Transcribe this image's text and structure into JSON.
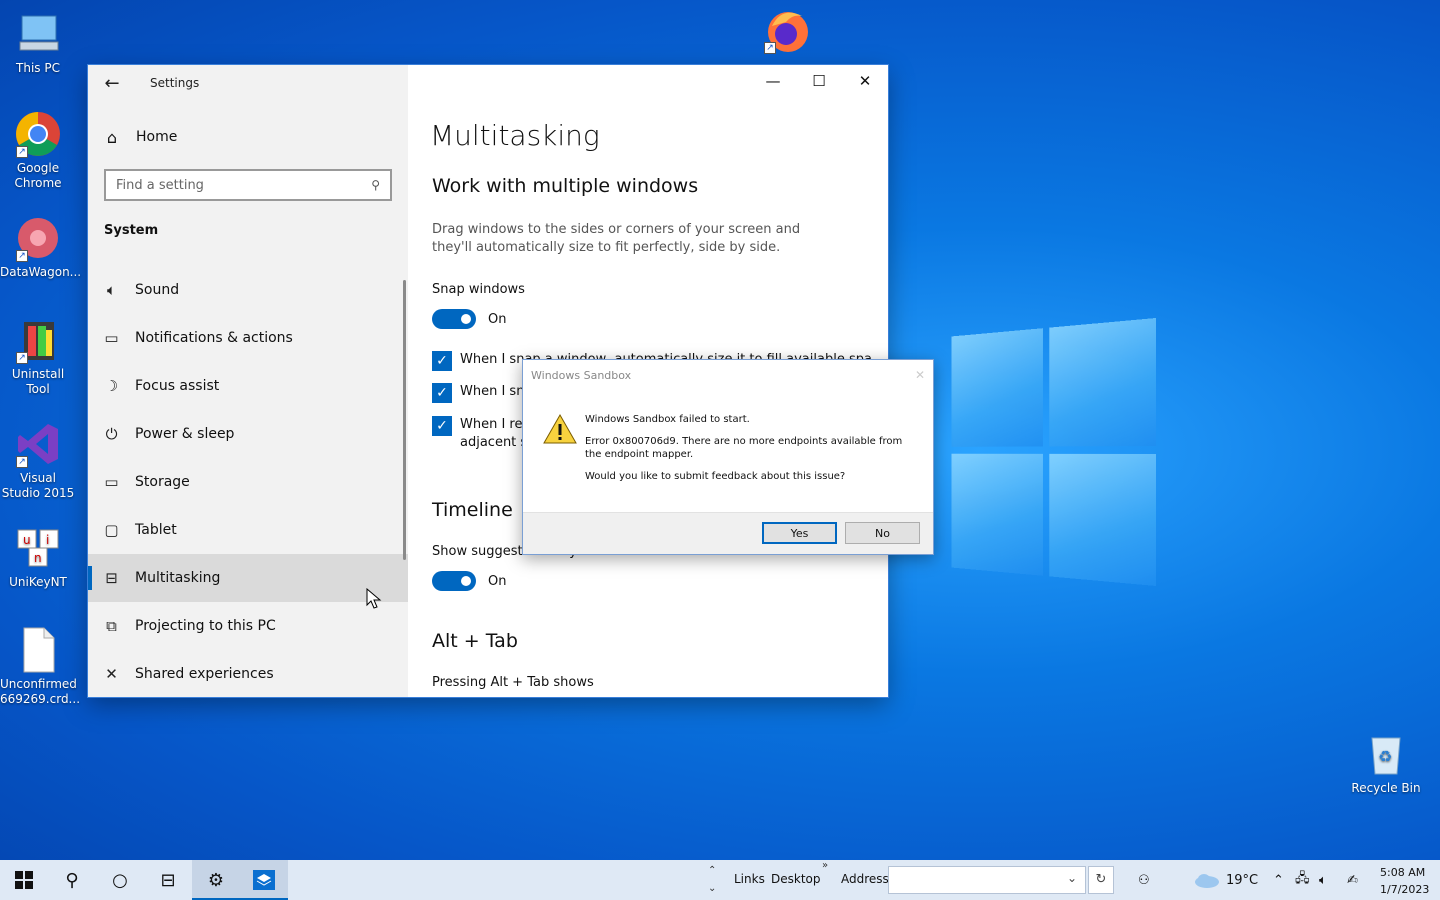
{
  "desktop": {
    "icons": [
      {
        "label": "This PC"
      },
      {
        "label": "Google Chrome"
      },
      {
        "label": "DataWagon..."
      },
      {
        "label": "Uninstall Tool"
      },
      {
        "label": "Visual Studio 2015"
      },
      {
        "label": "UniKeyNT"
      },
      {
        "label": "Unconfirmed 669269.crd..."
      },
      {
        "label": "Recycle Bin"
      }
    ]
  },
  "settings": {
    "title": "Settings",
    "home": "Home",
    "search_placeholder": "Find a setting",
    "section": "System",
    "nav": [
      {
        "label": "Sound",
        "icon": "speaker-icon"
      },
      {
        "label": "Notifications & actions",
        "icon": "notification-icon"
      },
      {
        "label": "Focus assist",
        "icon": "moon-icon"
      },
      {
        "label": "Power & sleep",
        "icon": "power-icon"
      },
      {
        "label": "Storage",
        "icon": "storage-icon"
      },
      {
        "label": "Tablet",
        "icon": "tablet-icon"
      },
      {
        "label": "Multitasking",
        "icon": "multitasking-icon",
        "active": true
      },
      {
        "label": "Projecting to this PC",
        "icon": "projector-icon"
      },
      {
        "label": "Shared experiences",
        "icon": "shared-icon"
      }
    ],
    "page_title": "Multitasking",
    "snap_section": "Work with multiple windows",
    "snap_desc": "Drag windows to the sides or corners of your screen and they'll automatically size to fit perfectly, side by side.",
    "snap_label": "Snap windows",
    "snap_state": "On",
    "checkboxes": [
      "When I snap a window, automatically size it to fill available space",
      "When I sn",
      "When I res",
      "adjacent s"
    ],
    "timeline_section": "Timeline",
    "timeline_label": "Show suggestions in your timeline",
    "timeline_state": "On",
    "alttab_section": "Alt + Tab",
    "alttab_label": "Pressing Alt + Tab shows"
  },
  "dialog": {
    "title": "Windows Sandbox",
    "line1": "Windows Sandbox failed to start.",
    "line2": "Error 0x800706d9. There are no more endpoints available from the endpoint mapper.",
    "line3": "Would you like to submit feedback about this issue?",
    "yes": "Yes",
    "no": "No"
  },
  "taskbar": {
    "links": "Links",
    "desktop": "Desktop",
    "address_label": "Address",
    "address_value": "",
    "weather": "19°C",
    "time": "5:08 AM",
    "date": "1/7/2023"
  },
  "colors": {
    "accent": "#0067c0"
  }
}
